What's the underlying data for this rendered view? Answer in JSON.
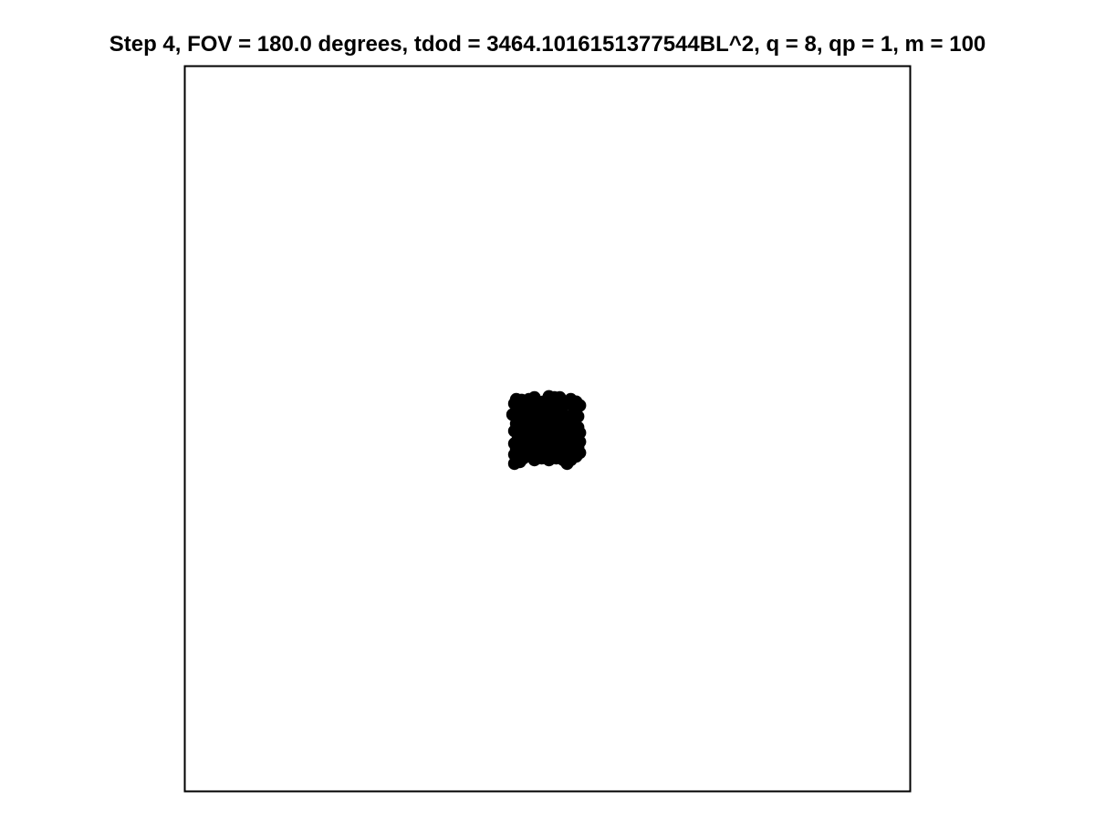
{
  "chart_data": {
    "type": "scatter",
    "title": "Step 4, FOV = 180.0 degrees, tdod = 3464.1016151377544BL^2, q = 8, qp = 1, m = 100",
    "xlabel": "",
    "ylabel": "",
    "xlim": [
      -100,
      100
    ],
    "ylim": [
      -100,
      100
    ],
    "grid": false,
    "axes_visible": false,
    "marker_color": "#000000",
    "frame_color": "#000000",
    "points": [
      {
        "x": -9.1,
        "y": 6.9
      },
      {
        "x": -8.6,
        "y": 8.1
      },
      {
        "x": -7.1,
        "y": 7.9
      },
      {
        "x": -5.1,
        "y": 8.1
      },
      {
        "x": -3.6,
        "y": 8.6
      },
      {
        "x": -1.1,
        "y": 7.4
      },
      {
        "x": 0.4,
        "y": 8.9
      },
      {
        "x": 1.9,
        "y": 8.6
      },
      {
        "x": 3.4,
        "y": 8.6
      },
      {
        "x": 5.4,
        "y": 7.4
      },
      {
        "x": 6.4,
        "y": 8.1
      },
      {
        "x": 7.9,
        "y": 7.4
      },
      {
        "x": -8.6,
        "y": 4.4
      },
      {
        "x": -6.6,
        "y": 5.4
      },
      {
        "x": -4.1,
        "y": 6.4
      },
      {
        "x": -1.6,
        "y": 5.4
      },
      {
        "x": -0.1,
        "y": 6.9
      },
      {
        "x": 1.9,
        "y": 6.4
      },
      {
        "x": 3.9,
        "y": 5.9
      },
      {
        "x": 5.9,
        "y": 6.9
      },
      {
        "x": 7.4,
        "y": 5.4
      },
      {
        "x": 8.9,
        "y": 6.4
      },
      {
        "x": -9.6,
        "y": 3.9
      },
      {
        "x": -7.6,
        "y": 2.9
      },
      {
        "x": -5.6,
        "y": 3.4
      },
      {
        "x": -3.6,
        "y": 3.9
      },
      {
        "x": -1.6,
        "y": 2.9
      },
      {
        "x": 0.4,
        "y": 3.9
      },
      {
        "x": 2.4,
        "y": 3.4
      },
      {
        "x": 4.4,
        "y": 3.9
      },
      {
        "x": 6.4,
        "y": 2.9
      },
      {
        "x": 8.4,
        "y": 3.4
      },
      {
        "x": -8.6,
        "y": 1.4
      },
      {
        "x": -6.6,
        "y": 0.9
      },
      {
        "x": -4.6,
        "y": 1.9
      },
      {
        "x": -2.6,
        "y": 1.4
      },
      {
        "x": -0.6,
        "y": 0.9
      },
      {
        "x": 1.4,
        "y": 1.9
      },
      {
        "x": 3.4,
        "y": 1.4
      },
      {
        "x": 5.4,
        "y": 0.9
      },
      {
        "x": 7.4,
        "y": 1.9
      },
      {
        "x": 8.4,
        "y": 0.4
      },
      {
        "x": -9.1,
        "y": -0.6
      },
      {
        "x": -7.1,
        "y": -1.6
      },
      {
        "x": -5.1,
        "y": -0.6
      },
      {
        "x": -3.1,
        "y": -1.1
      },
      {
        "x": -1.1,
        "y": -0.1
      },
      {
        "x": 0.9,
        "y": -1.1
      },
      {
        "x": 2.9,
        "y": -0.6
      },
      {
        "x": 4.9,
        "y": -1.6
      },
      {
        "x": 6.9,
        "y": -0.6
      },
      {
        "x": 8.9,
        "y": -1.1
      },
      {
        "x": -8.1,
        "y": -2.6
      },
      {
        "x": -6.1,
        "y": -3.1
      },
      {
        "x": -4.1,
        "y": -2.1
      },
      {
        "x": -2.1,
        "y": -3.1
      },
      {
        "x": -0.1,
        "y": -2.6
      },
      {
        "x": 1.9,
        "y": -3.1
      },
      {
        "x": 3.9,
        "y": -2.1
      },
      {
        "x": 5.9,
        "y": -3.1
      },
      {
        "x": 7.9,
        "y": -2.6
      },
      {
        "x": 8.9,
        "y": -3.6
      },
      {
        "x": -9.1,
        "y": -4.1
      },
      {
        "x": -7.1,
        "y": -4.6
      },
      {
        "x": -5.1,
        "y": -3.6
      },
      {
        "x": -3.1,
        "y": -4.6
      },
      {
        "x": -1.1,
        "y": -4.1
      },
      {
        "x": 0.9,
        "y": -5.1
      },
      {
        "x": 2.9,
        "y": -4.1
      },
      {
        "x": 4.9,
        "y": -4.6
      },
      {
        "x": 6.9,
        "y": -4.1
      },
      {
        "x": 8.4,
        "y": -5.1
      },
      {
        "x": -8.6,
        "y": -5.6
      },
      {
        "x": -6.6,
        "y": -6.1
      },
      {
        "x": -4.6,
        "y": -5.1
      },
      {
        "x": -2.6,
        "y": -6.1
      },
      {
        "x": -0.6,
        "y": -5.6
      },
      {
        "x": 1.4,
        "y": -6.1
      },
      {
        "x": 3.4,
        "y": -5.6
      },
      {
        "x": 5.4,
        "y": -6.1
      },
      {
        "x": 7.4,
        "y": -5.6
      },
      {
        "x": 8.9,
        "y": -6.6
      },
      {
        "x": -9.1,
        "y": -7.1
      },
      {
        "x": -7.1,
        "y": -7.6
      },
      {
        "x": -5.1,
        "y": -7.1
      },
      {
        "x": -3.1,
        "y": -7.6
      },
      {
        "x": -1.1,
        "y": -7.1
      },
      {
        "x": 0.9,
        "y": -7.6
      },
      {
        "x": 2.9,
        "y": -7.1
      },
      {
        "x": 4.9,
        "y": -7.6
      },
      {
        "x": 6.4,
        "y": -7.1
      },
      {
        "x": 7.9,
        "y": -7.6
      },
      {
        "x": -8.6,
        "y": -8.6
      },
      {
        "x": -6.6,
        "y": -8.1
      },
      {
        "x": -3.6,
        "y": -8.6
      },
      {
        "x": -1.6,
        "y": -8.1
      },
      {
        "x": 0.4,
        "y": -8.6
      },
      {
        "x": 2.4,
        "y": -8.1
      },
      {
        "x": 4.4,
        "y": -8.6
      },
      {
        "x": 6.4,
        "y": -8.6
      },
      {
        "x": -9.1,
        "y": -9.6
      },
      {
        "x": -7.6,
        "y": -9.1
      },
      {
        "x": 5.4,
        "y": -9.6
      }
    ]
  }
}
